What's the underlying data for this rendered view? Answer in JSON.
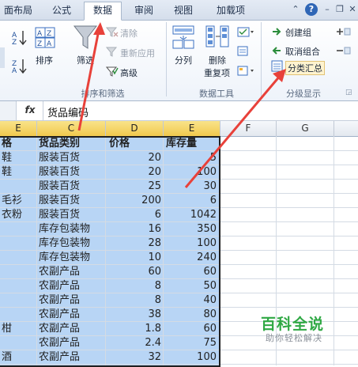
{
  "tabs": [
    "面布局",
    "公式",
    "数据",
    "审阅",
    "视图",
    "加载项"
  ],
  "active_tab": "数据",
  "window_controls": {
    "collapse": "⌃",
    "help": "?",
    "minimize": "–",
    "restore": "❐",
    "close": "✕"
  },
  "ribbon": {
    "sort_filter": {
      "sort_label": "排序",
      "filter_label": "筛选",
      "clear": "清除",
      "reapply": "重新应用",
      "advanced": "高级",
      "group_label": "排序和筛选"
    },
    "data_tools": {
      "split_label": "分列",
      "remove_label": "删除",
      "dup_label": "重复项",
      "group_label": "数据工具"
    },
    "outline": {
      "create_group": "创建组",
      "ungroup": "取消组合",
      "subtotal": "分类汇总",
      "group_label": "分级显示"
    }
  },
  "formula_bar": {
    "fx": "fx",
    "value": "货品编码"
  },
  "columns": [
    "E",
    "C",
    "D",
    "E",
    "F",
    "G"
  ],
  "headers": [
    "格",
    "货品类别",
    "价格",
    "库存量"
  ],
  "rows": [
    {
      "b": "鞋",
      "c": "服装百货",
      "d": "20",
      "e": "5"
    },
    {
      "b": "鞋",
      "c": "服装百货",
      "d": "20",
      "e": "100"
    },
    {
      "b": "",
      "c": "服装百货",
      "d": "25",
      "e": "30"
    },
    {
      "b": "毛衫",
      "c": "服装百货",
      "d": "200",
      "e": "6"
    },
    {
      "b": "衣粉",
      "c": "服装百货",
      "d": "6",
      "e": "1042"
    },
    {
      "b": "",
      "c": "库存包装物",
      "d": "16",
      "e": "350"
    },
    {
      "b": "",
      "c": "库存包装物",
      "d": "28",
      "e": "100"
    },
    {
      "b": "",
      "c": "库存包装物",
      "d": "10",
      "e": "240"
    },
    {
      "b": "",
      "c": "农副产品",
      "d": "60",
      "e": "60"
    },
    {
      "b": "",
      "c": "农副产品",
      "d": "8",
      "e": "50"
    },
    {
      "b": "",
      "c": "农副产品",
      "d": "8",
      "e": "40"
    },
    {
      "b": "",
      "c": "农副产品",
      "d": "38",
      "e": "80"
    },
    {
      "b": "柑",
      "c": "农副产品",
      "d": "1.8",
      "e": "60"
    },
    {
      "b": "",
      "c": "农副产品",
      "d": "2.4",
      "e": "75"
    },
    {
      "b": "酒",
      "c": "农副产品",
      "d": "32",
      "e": "100"
    }
  ],
  "watermark": {
    "title": "百科全说",
    "subtitle": "助你轻松解决"
  },
  "colors": {
    "accent_arrow": "#e8413a",
    "selection": "#b8d5f5",
    "header_sel": "#f1c94e",
    "watermark": "#2fa844"
  }
}
